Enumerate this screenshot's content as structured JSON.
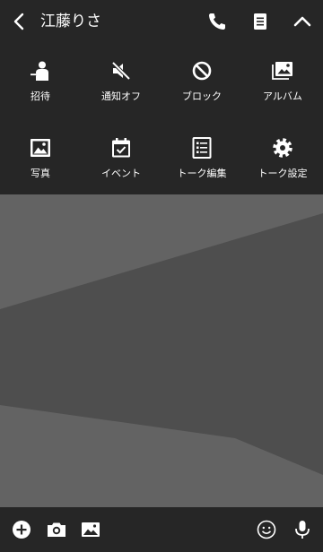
{
  "header": {
    "title": "江藤りさ",
    "icons": [
      "back-icon",
      "phone-icon",
      "notes-icon",
      "collapse-icon"
    ]
  },
  "menu": {
    "items": [
      {
        "label": "招待",
        "icon": "invite-icon"
      },
      {
        "label": "通知オフ",
        "icon": "mute-icon"
      },
      {
        "label": "ブロック",
        "icon": "block-icon"
      },
      {
        "label": "アルバム",
        "icon": "album-icon"
      },
      {
        "label": "写真",
        "icon": "photo-icon"
      },
      {
        "label": "イベント",
        "icon": "event-icon"
      },
      {
        "label": "トーク編集",
        "icon": "edit-talk-icon"
      },
      {
        "label": "トーク設定",
        "icon": "settings-icon"
      }
    ]
  },
  "footer": {
    "icons": [
      "plus-icon",
      "camera-icon",
      "image-icon",
      "emoji-icon",
      "microphone-icon"
    ]
  },
  "colors": {
    "bar": "#262626",
    "background": "#5a5a5a",
    "band_light": "#636363",
    "band_dark": "#4e4e4e",
    "icon": "#ffffff"
  }
}
